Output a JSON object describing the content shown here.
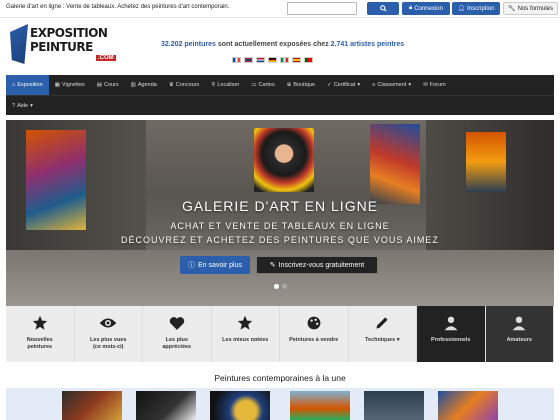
{
  "topbar": {
    "tagline": "Galerie d'art en ligne : Vente de tableaux. Achetez des peintures d'art contemporain.",
    "search_placeholder": "",
    "login_label": "Connexion",
    "register_label": "Inscription",
    "formulas_label": "Nos formules"
  },
  "header": {
    "logo_line1": "EXPOSITION",
    "logo_line2": "PEINTURE",
    "logo_line3": ".COM",
    "stats_paintings": "32.202 peintures",
    "stats_middle": " sont actuellement exposées chez ",
    "stats_artists": "2.741 artistes peintres"
  },
  "flags": [
    "fr",
    "en",
    "nl",
    "de",
    "it",
    "es",
    "pt"
  ],
  "nav": {
    "items": [
      {
        "label": "Exposition",
        "icon": "home-icon",
        "active": true
      },
      {
        "label": "Vignettes",
        "icon": "grid-icon"
      },
      {
        "label": "Cours",
        "icon": "book-icon"
      },
      {
        "label": "Agenda",
        "icon": "calendar-icon"
      },
      {
        "label": "Concours",
        "icon": "trophy-icon"
      },
      {
        "label": "Localiser",
        "icon": "location-icon"
      },
      {
        "label": "Cartes",
        "icon": "card-icon"
      },
      {
        "label": "Boutique",
        "icon": "shop-icon"
      },
      {
        "label": "Certificat",
        "icon": "certificate-icon"
      },
      {
        "label": "Classement",
        "icon": "ranking-icon"
      },
      {
        "label": "Forum",
        "icon": "forum-icon"
      }
    ],
    "row2": [
      {
        "label": "Aide",
        "icon": "help-icon"
      }
    ]
  },
  "hero": {
    "title": "GALERIE D'ART EN LIGNE",
    "subtitle1": "ACHAT ET VENTE DE TABLEAUX EN LIGNE",
    "subtitle2": "DÉCOUVREZ ET ACHETEZ DES PEINTURES QUE VOUS AIMEZ",
    "btn_more": "En savoir plus",
    "btn_signup": "Inscrivez-vous gratuitement"
  },
  "categories": [
    {
      "label": "Nouvelles\npeintures",
      "icon": "star-icon"
    },
    {
      "label": "Les plus vues\n(ce mois-ci)",
      "icon": "eye-icon"
    },
    {
      "label": "Les plus\nappréciées",
      "icon": "heart-icon"
    },
    {
      "label": "Les mieux notées",
      "icon": "star-icon"
    },
    {
      "label": "Peintures à vendre",
      "icon": "palette-icon"
    },
    {
      "label": "Techniques ▾",
      "icon": "pencil-icon"
    },
    {
      "label": "Professionnels",
      "icon": "user-icon"
    },
    {
      "label": "Amateurs",
      "icon": "user-icon"
    }
  ],
  "section": {
    "title": "Peintures contemporaines à la une"
  },
  "colors": {
    "brand": "#2b5eab",
    "nav_bg": "#222222",
    "accent_red": "#c62828"
  }
}
